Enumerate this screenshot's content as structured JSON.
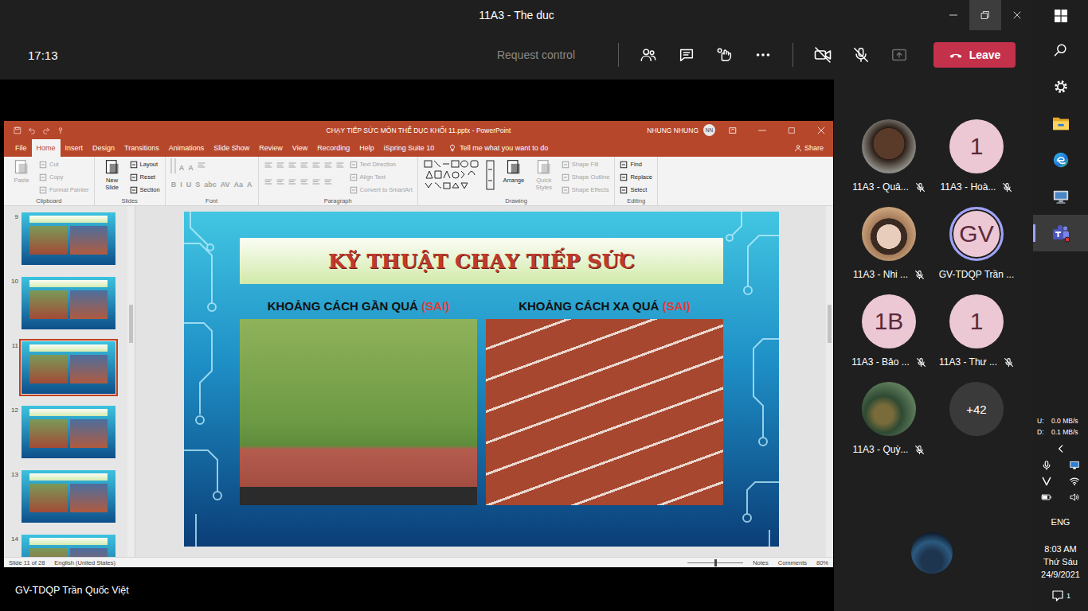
{
  "window": {
    "title": "11A3 - The duc"
  },
  "meeting_bar": {
    "timer": "17:13",
    "request_control": {
      "label": "Request control",
      "disabled": true
    },
    "camera_on": false,
    "mic_muted": true,
    "share_disabled": true,
    "leave": "Leave"
  },
  "powerpoint": {
    "title": "CHẠY TIẾP SỨC MÔN THỂ DỤC KHỐI 11.pptx - PowerPoint",
    "user": {
      "name": "NHUNG NHUNG",
      "initials": "NN"
    },
    "tabs": [
      {
        "label": "File",
        "selected": false
      },
      {
        "label": "Home",
        "selected": true
      },
      {
        "label": "Insert",
        "selected": false
      },
      {
        "label": "Design",
        "selected": false
      },
      {
        "label": "Transitions",
        "selected": false
      },
      {
        "label": "Animations",
        "selected": false
      },
      {
        "label": "Slide Show",
        "selected": false
      },
      {
        "label": "Review",
        "selected": false
      },
      {
        "label": "View",
        "selected": false
      },
      {
        "label": "Recording",
        "selected": false
      },
      {
        "label": "Help",
        "selected": false
      },
      {
        "label": "iSpring Suite 10",
        "selected": false
      }
    ],
    "tell_me": "Tell me what you want to do",
    "share": "Share",
    "ribbon": [
      {
        "name": "Clipboard",
        "columns": [
          [
            [
              {
                "kind": "large",
                "label": "Paste",
                "disabled": true
              }
            ]
          ],
          [
            [
              {
                "kind": "small",
                "label": "Cut",
                "disabled": true
              }
            ],
            [
              {
                "kind": "small",
                "label": "Copy",
                "disabled": true
              }
            ],
            [
              {
                "kind": "small",
                "label": "Format Painter",
                "disabled": true
              }
            ]
          ]
        ]
      },
      {
        "name": "Slides",
        "columns": [
          [
            [
              {
                "kind": "large",
                "label": "New Slide",
                "disabled": false
              }
            ]
          ],
          [
            [
              {
                "kind": "small",
                "label": "Layout",
                "disabled": false
              }
            ],
            [
              {
                "kind": "small",
                "label": "Reset",
                "disabled": false
              }
            ],
            [
              {
                "kind": "small",
                "label": "Section",
                "disabled": false
              }
            ]
          ]
        ]
      },
      {
        "name": "Font",
        "columns": [
          [
            [
              {
                "kind": "font-field",
                "disabled": true
              },
              {
                "kind": "size-field",
                "disabled": true
              },
              {
                "kind": "glyph",
                "label": "A",
                "disabled": true
              },
              {
                "kind": "glyph",
                "label": "A",
                "disabled": true
              },
              {
                "kind": "icon",
                "disabled": true
              }
            ],
            [
              {
                "kind": "glyph",
                "label": "B",
                "disabled": true
              },
              {
                "kind": "glyph",
                "label": "I",
                "disabled": true
              },
              {
                "kind": "glyph",
                "label": "U",
                "disabled": true
              },
              {
                "kind": "glyph",
                "label": "S",
                "disabled": true
              },
              {
                "kind": "glyph",
                "label": "abc",
                "disabled": true
              },
              {
                "kind": "glyph",
                "label": "AV",
                "disabled": true
              },
              {
                "kind": "glyph",
                "label": "Aa",
                "disabled": true
              },
              {
                "kind": "glyph",
                "label": "A",
                "disabled": true
              }
            ]
          ]
        ]
      },
      {
        "name": "Paragraph",
        "columns": [
          [
            [
              {
                "kind": "icon",
                "disabled": true
              },
              {
                "kind": "icon",
                "disabled": true
              },
              {
                "kind": "icon",
                "disabled": true
              },
              {
                "kind": "icon",
                "disabled": true
              },
              {
                "kind": "icon",
                "disabled": true
              },
              {
                "kind": "icon",
                "disabled": true
              },
              {
                "kind": "icon",
                "disabled": true
              }
            ],
            [
              {
                "kind": "icon",
                "disabled": true
              },
              {
                "kind": "icon",
                "disabled": true
              },
              {
                "kind": "icon",
                "disabled": true
              },
              {
                "kind": "icon",
                "disabled": true
              },
              {
                "kind": "icon",
                "disabled": true
              },
              {
                "kind": "icon",
                "disabled": true
              }
            ]
          ],
          [
            [
              {
                "kind": "small",
                "label": "Text Direction",
                "disabled": true
              }
            ],
            [
              {
                "kind": "small",
                "label": "Align Text",
                "disabled": true
              }
            ],
            [
              {
                "kind": "small",
                "label": "Convert to SmartArt",
                "disabled": true
              }
            ]
          ]
        ]
      },
      {
        "name": "Drawing",
        "columns": [
          [
            [
              {
                "kind": "gallery",
                "disabled": false
              }
            ]
          ],
          [
            [
              {
                "kind": "large",
                "label": "Arrange",
                "disabled": false
              }
            ]
          ],
          [
            [
              {
                "kind": "large",
                "label": "Quick Styles",
                "disabled": true
              }
            ]
          ],
          [
            [
              {
                "kind": "small",
                "label": "Shape Fill",
                "disabled": true
              }
            ],
            [
              {
                "kind": "small",
                "label": "Shape Outline",
                "disabled": true
              }
            ],
            [
              {
                "kind": "small",
                "label": "Shape Effects",
                "disabled": true
              }
            ]
          ]
        ]
      },
      {
        "name": "Editing",
        "columns": [
          [
            [
              {
                "kind": "small",
                "label": "Find",
                "disabled": false
              }
            ],
            [
              {
                "kind": "small",
                "label": "Replace",
                "disabled": false
              }
            ],
            [
              {
                "kind": "small",
                "label": "Select",
                "disabled": false
              }
            ]
          ]
        ]
      }
    ],
    "slides": [
      {
        "number": "9",
        "selected": false
      },
      {
        "number": "10",
        "selected": false
      },
      {
        "number": "11",
        "selected": true
      },
      {
        "number": "12",
        "selected": false
      },
      {
        "number": "13",
        "selected": false
      },
      {
        "number": "14",
        "selected": false
      }
    ],
    "slide": {
      "title": "KỸ THUẬT CHẠY TIẾP SỨC",
      "panels": [
        {
          "caption": "KHOẢNG CÁCH GẦN QUÁ",
          "verdict": "(SAI)"
        },
        {
          "caption": "KHOẢNG CÁCH XA QUÁ",
          "verdict": "(SAI)"
        }
      ]
    },
    "status": {
      "slide": "Slide 11 of 28",
      "language": "English (United States)",
      "notes": "Notes",
      "comments": "Comments",
      "zoom": "80%",
      "zoom_level": 0.5
    }
  },
  "presenter": "GV-TDQP Trần Quốc Việt",
  "participants": [
    {
      "name": "11A3 - Quâ...",
      "kind": "photo",
      "muted": true,
      "speaking": false
    },
    {
      "name": "11A3 - Hoà...",
      "kind": "initials",
      "initials": "1",
      "muted": true,
      "speaking": false
    },
    {
      "name": "11A3 - Nhi ...",
      "kind": "photo",
      "muted": true,
      "speaking": false
    },
    {
      "name": "GV-TDQP Trần ...",
      "kind": "initials",
      "initials": "GV",
      "muted": false,
      "speaking": true
    },
    {
      "name": "11A3 - Bảo ...",
      "kind": "initials",
      "initials": "1B",
      "muted": true,
      "speaking": false
    },
    {
      "name": "11A3 - Thư ...",
      "kind": "initials",
      "initials": "1",
      "muted": true,
      "speaking": false
    },
    {
      "name": "11A3 - Quỳ...",
      "kind": "photo",
      "muted": true,
      "speaking": false
    }
  ],
  "overflow": "+42",
  "self_view": {
    "kind": "photo"
  },
  "taskbar": {
    "apps": [
      {
        "kind": "start",
        "selected": false
      },
      {
        "kind": "search",
        "selected": false
      },
      {
        "kind": "settings",
        "selected": false
      },
      {
        "kind": "explorer",
        "selected": false
      },
      {
        "kind": "edge",
        "selected": false
      },
      {
        "kind": "monitor",
        "selected": false
      },
      {
        "kind": "teams",
        "selected": true
      }
    ],
    "network": [
      {
        "label": "U:",
        "value": "0.0 MB/s"
      },
      {
        "label": "D:",
        "value": "0.1 MB/s"
      }
    ],
    "tray": [
      {
        "kind": "mic"
      },
      {
        "kind": "display"
      },
      {
        "kind": "vpn"
      },
      {
        "kind": "wifi"
      },
      {
        "kind": "battery"
      },
      {
        "kind": "volume"
      }
    ],
    "language": "ENG",
    "clock": {
      "time": "8:03 AM",
      "day": "Thứ Sáu",
      "date": "24/9/2021"
    },
    "notifications": "1"
  }
}
